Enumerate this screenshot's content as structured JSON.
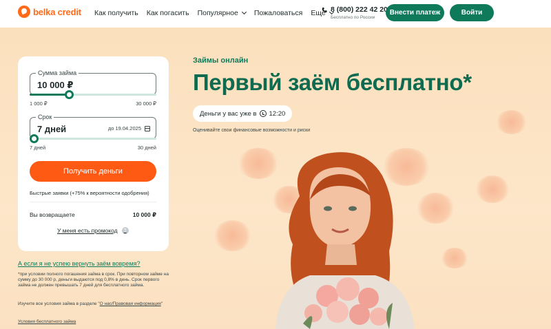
{
  "header": {
    "logo_text": "belka credit",
    "nav": [
      {
        "label": "Как получить",
        "dropdown": false
      },
      {
        "label": "Как погасить",
        "dropdown": false
      },
      {
        "label": "Популярное",
        "dropdown": true
      },
      {
        "label": "Пожаловаться",
        "dropdown": false
      },
      {
        "label": "Ещё",
        "dropdown": true
      }
    ],
    "phone": "8 (800) 222 42 20",
    "phone_sub": "Бесплатно по России",
    "pay_button": "Внести платеж",
    "login_button": "Войти"
  },
  "calculator": {
    "amount": {
      "legend": "Сумма займа",
      "value": "10 000 ₽",
      "min": "1 000 ₽",
      "max": "30 000 ₽",
      "slider_fraction": 0.31
    },
    "term": {
      "legend": "Срок",
      "value": "7 дней",
      "until": "до 19.04.2025",
      "min": "7 дней",
      "max": "30 дней",
      "slider_fraction": 0.0
    },
    "submit_button": "Получить деньги",
    "fast_note": "Быстрые заявки (+75% к вероятности одобрения)",
    "return_label": "Вы возвращаете",
    "return_value": "10 000 ₽",
    "promo_link": "У меня есть промокод",
    "promo_help": "?"
  },
  "info": {
    "faq_link": "А если я не успею вернуть заём вовремя?",
    "footnote": "*при условии полного погашения займа в срок. При повторном займе на сумму до 30 000 р, деньги выдаются под 0,8% в день. Срок первого займа не должен превышать 7 дней для бесплатного займа.",
    "terms_prefix": "Изучите все условия займа в разделе \"",
    "terms_link": "О нас/Правовая информация",
    "terms_suffix": "\"",
    "free_terms_link": "Условия бесплатного займа"
  },
  "hero": {
    "eyebrow": "Займы онлайн",
    "headline": "Первый заём бесплатно*",
    "chip_text": "Деньги у вас уже в",
    "chip_time": "12:20",
    "subtext": "Оценивайте свои финансовые возможности и риски"
  },
  "colors": {
    "brand_green": "#0e7a5a",
    "accent_orange": "#ff5a14",
    "logo_orange": "#ff6a1a",
    "hero_bg": "#fbe0bd"
  }
}
